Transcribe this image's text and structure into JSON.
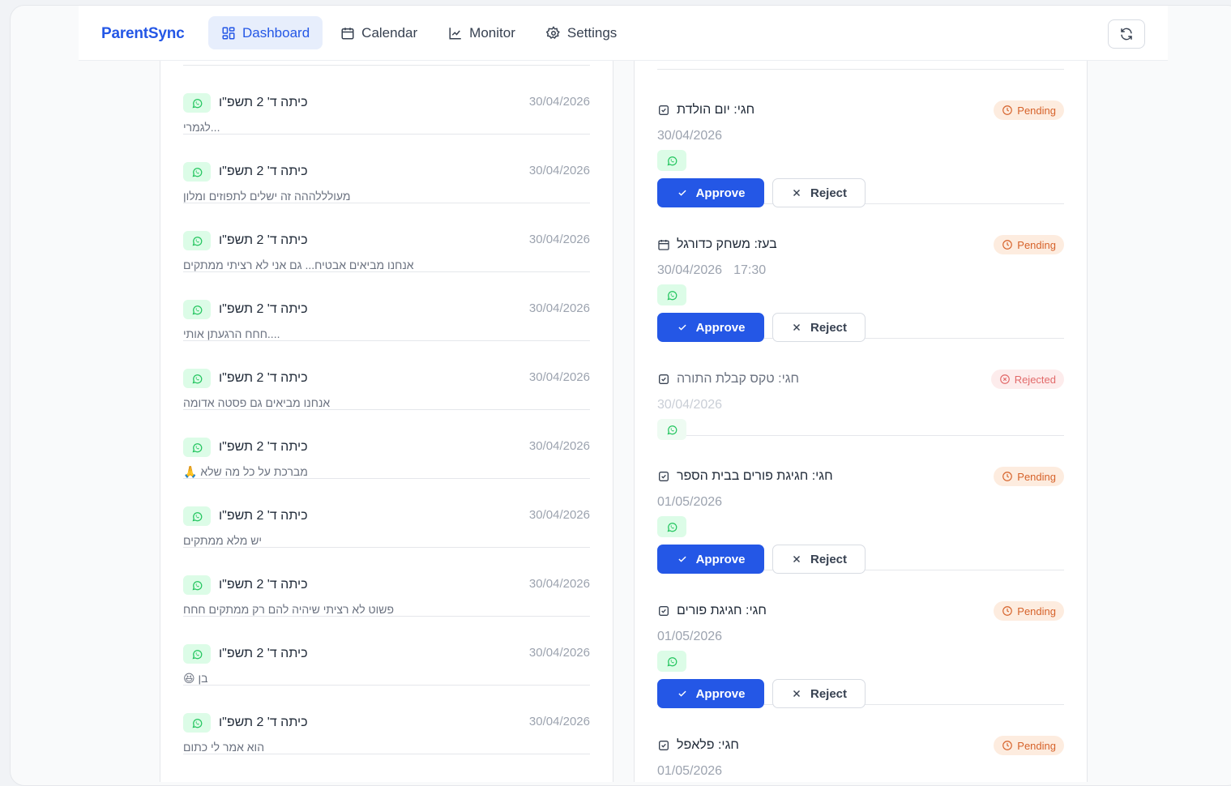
{
  "app": {
    "brand": "ParentSync",
    "nav": [
      {
        "label": "Dashboard",
        "icon": "dashboard-grid-icon",
        "active": true
      },
      {
        "label": "Calendar",
        "icon": "calendar-icon",
        "active": false
      },
      {
        "label": "Monitor",
        "icon": "chart-line-icon",
        "active": false
      },
      {
        "label": "Settings",
        "icon": "gear-icon",
        "active": false
      }
    ],
    "refresh_icon": "refresh-icon"
  },
  "colors": {
    "accent": "#2457e6",
    "whatsapp": "#22c55e",
    "pending": "#d6622a",
    "rejected": "#e26a6a"
  },
  "messages": [
    {
      "group": "כיתה ד' 2 תשפ\"ו",
      "date": "30/04/2026",
      "text": "...לגמרי"
    },
    {
      "group": "כיתה ד' 2 תשפ\"ו",
      "date": "30/04/2026",
      "text": "מעולללההה זה ישלים לתפוזים ומלון"
    },
    {
      "group": "כיתה ד' 2 תשפ\"ו",
      "date": "30/04/2026",
      "text": "אנחנו מביאים אבטיח... גם אני לא רציתי ממתקים"
    },
    {
      "group": "כיתה ד' 2 תשפ\"ו",
      "date": "30/04/2026",
      "text": "....חחח הרגעתן אותי"
    },
    {
      "group": "כיתה ד' 2 תשפ\"ו",
      "date": "30/04/2026",
      "text": "אנחנו מביאים גם פסטה אדומה"
    },
    {
      "group": "כיתה ד' 2 תשפ\"ו",
      "date": "30/04/2026",
      "text": "מברכת על כל מה שלא 🙏"
    },
    {
      "group": "כיתה ד' 2 תשפ\"ו",
      "date": "30/04/2026",
      "text": "יש מלא ממתקים"
    },
    {
      "group": "כיתה ד' 2 תשפ\"ו",
      "date": "30/04/2026",
      "text": "פשוט לא רציתי שיהיה להם רק ממתקים חחח"
    },
    {
      "group": "כיתה ד' 2 תשפ\"ו",
      "date": "30/04/2026",
      "text": "בן 😆"
    },
    {
      "group": "כיתה ד' 2 תשפ\"ו",
      "date": "30/04/2026",
      "text": "הוא אמר לי כתום"
    }
  ],
  "events": [
    {
      "title": "חגי: יום הולדת",
      "icon": "checkbox-icon",
      "date": "30/04/2026",
      "time": "",
      "status": "Pending",
      "kind": "pending",
      "approve": "Approve",
      "reject": "Reject"
    },
    {
      "title": "בעז: משחק כדורגל",
      "icon": "calendar-icon",
      "date": "30/04/2026",
      "time": "17:30",
      "status": "Pending",
      "kind": "pending",
      "approve": "Approve",
      "reject": "Reject"
    },
    {
      "title": "חגי: טקס קבלת התורה",
      "icon": "checkbox-icon",
      "date": "30/04/2026",
      "time": "",
      "status": "Rejected",
      "kind": "rejected"
    },
    {
      "title": "חגי: חגיגת פורים בבית הספר",
      "icon": "checkbox-icon",
      "date": "01/05/2026",
      "time": "",
      "status": "Pending",
      "kind": "pending",
      "approve": "Approve",
      "reject": "Reject"
    },
    {
      "title": "חגי: חגיגת פורים",
      "icon": "checkbox-icon",
      "date": "01/05/2026",
      "time": "",
      "status": "Pending",
      "kind": "pending",
      "approve": "Approve",
      "reject": "Reject"
    },
    {
      "title": "חגי: פלאפל",
      "icon": "checkbox-icon",
      "date": "01/05/2026",
      "time": "",
      "status": "Pending",
      "kind": "last"
    }
  ]
}
